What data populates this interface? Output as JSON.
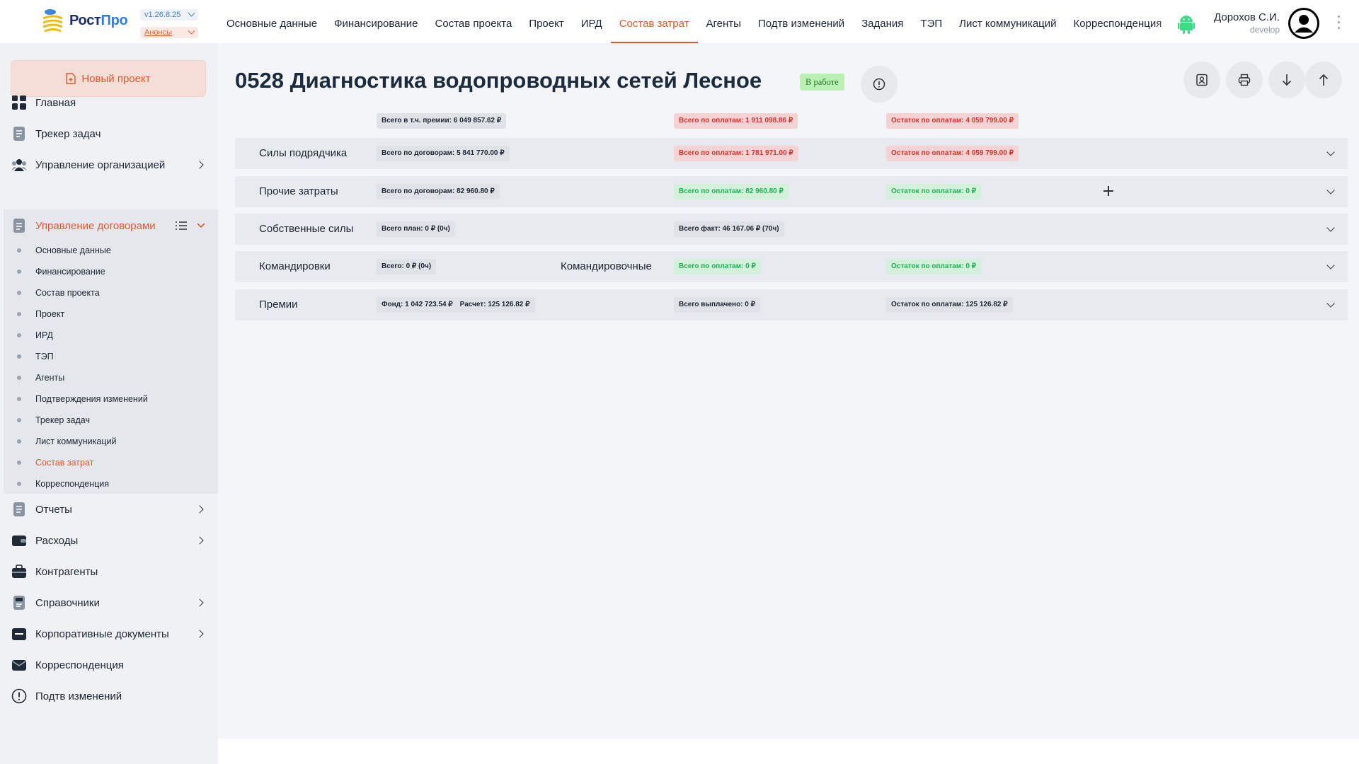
{
  "app": {
    "logo_prefix": "Рост",
    "logo_suffix": "Про",
    "version": "v1.26.8.25",
    "news": "Анонсы"
  },
  "topnav": [
    {
      "label": "Основные данные",
      "active": false
    },
    {
      "label": "Финансирование",
      "active": false
    },
    {
      "label": "Состав проекта",
      "active": false
    },
    {
      "label": "Проект",
      "active": false
    },
    {
      "label": "ИРД",
      "active": false
    },
    {
      "label": "Состав затрат",
      "active": true
    },
    {
      "label": "Агенты",
      "active": false
    },
    {
      "label": "Подтв изменений",
      "active": false
    },
    {
      "label": "Задания",
      "active": false
    },
    {
      "label": "ТЭП",
      "active": false
    },
    {
      "label": "Лист коммуникаций",
      "active": false
    },
    {
      "label": "Корреспонденция",
      "active": false
    }
  ],
  "user": {
    "name": "Дорохов С.И.",
    "role": "develop"
  },
  "sidebar": {
    "new_project": "Новый проект",
    "items": [
      {
        "label": "Главная",
        "icon": "dashboard-icon"
      },
      {
        "label": "Трекер задач",
        "icon": "task-tracker-icon"
      },
      {
        "label": "Управление организацией",
        "icon": "organization-icon"
      },
      {
        "label": "Управление договорами",
        "icon": "contracts-icon"
      },
      {
        "label": "Отчеты",
        "icon": "reports-icon"
      },
      {
        "label": "Расходы",
        "icon": "wallet-icon"
      },
      {
        "label": "Контрагенты",
        "icon": "briefcase-icon"
      },
      {
        "label": "Справочники",
        "icon": "reference-book-icon"
      },
      {
        "label": "Корпоративные документы",
        "icon": "corporate-docs-icon"
      },
      {
        "label": "Корреспонденция",
        "icon": "mail-icon"
      },
      {
        "label": "Подтв изменений",
        "icon": "alert-circle-icon"
      }
    ],
    "sub_items": [
      "Основные данные",
      "Финансирование",
      "Состав проекта",
      "Проект",
      "ИРД",
      "ТЭП",
      "Агенты",
      "Подтверждения изменений",
      "Трекер задач",
      "Лист коммуникаций",
      "Состав затрат",
      "Корреспонденция"
    ]
  },
  "page": {
    "title": "0528 Диагностика водопроводных сетей Лесное",
    "status": "В работе"
  },
  "summary": {
    "total_incl_bonus": "Всего в т.ч. премии: 6 049 857.62 ₽",
    "total_paid": "Всего по оплатам: 1 911 098.86 ₽",
    "remaining_paid": "Остаток по оплатам: 4 059 799.00 ₽"
  },
  "rows": {
    "contractor": {
      "label": "Силы подрядчика",
      "contracts": "Всего по договорам: 5 841 770.00 ₽",
      "paid": "Всего по оплатам: 1 781 971.00 ₽",
      "remaining": "Остаток по оплатам: 4 059 799.00 ₽"
    },
    "other": {
      "label": "Прочие затраты",
      "contracts": "Всего по договорам: 82 960.80 ₽",
      "paid": "Всего по оплатам: 82 960.80 ₽",
      "remaining": "Остаток по оплатам: 0 ₽"
    },
    "own": {
      "label": "Собственные силы",
      "plan": "Всего план: 0 ₽  (0ч)",
      "fact": "Всего факт:  46 167.06 ₽ (70ч)"
    },
    "trips": {
      "label": "Командировки",
      "total": "Всего:  0 ₽ (0ч)",
      "label2": "Командировочные",
      "paid": "Всего по оплатам: 0 ₽",
      "remaining": "Остаток по оплатам: 0 ₽"
    },
    "bonus": {
      "label": "Премии",
      "fund": "Фонд: 1 042 723.54 ₽",
      "calc": "Расчет: 125 126.82 ₽",
      "paid": "Всего выплачено: 0 ₽",
      "remaining": "Остаток по оплатам: 125 126.82 ₽"
    }
  },
  "colors": {
    "accent": "#e4572e",
    "danger": "#d5312b",
    "success": "#1fb052",
    "status_badge_bg": "#b9f0b4"
  }
}
